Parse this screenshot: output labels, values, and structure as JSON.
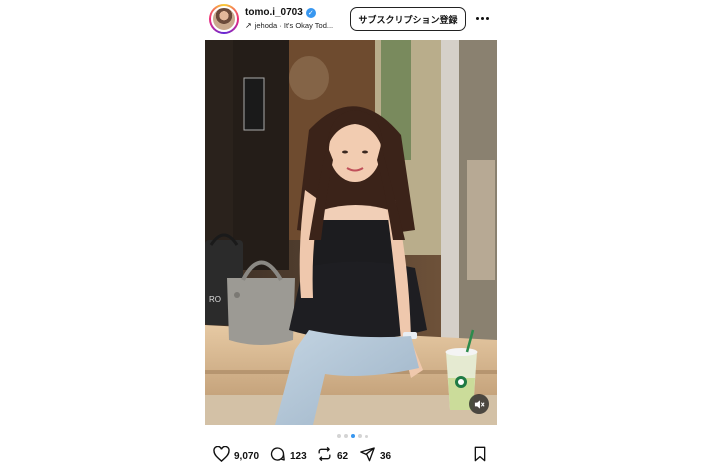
{
  "header": {
    "username": "tomo.i_0703",
    "music": "jehoda · It's Okay Tod...",
    "subscribe_label": "サブスクリプション登録"
  },
  "carousel": {
    "total": 5,
    "active_index": 3
  },
  "actions": {
    "likes": "9,070",
    "comments": "123",
    "reposts": "62",
    "shares": "36"
  },
  "icons": {
    "verified": "verified-badge-icon",
    "music": "arrow-up-right-icon",
    "more": "more-options-icon",
    "mute": "mute-icon",
    "like": "heart-icon",
    "comment": "comment-icon",
    "repost": "repost-icon",
    "share": "send-icon",
    "save": "bookmark-icon"
  },
  "colors": {
    "accent": "#3897f0"
  }
}
